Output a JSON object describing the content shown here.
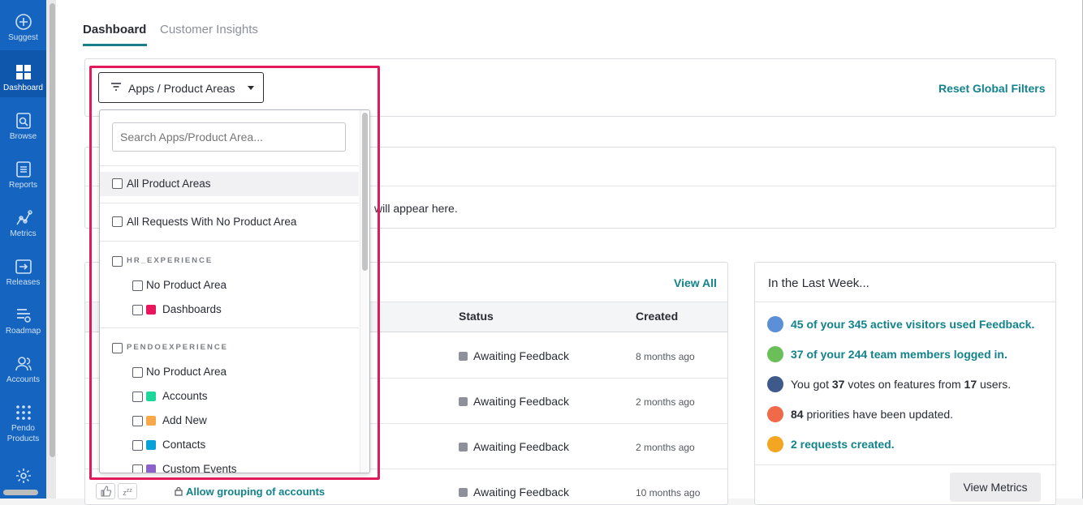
{
  "nav": {
    "suggest": "Suggest",
    "dashboard": "Dashboard",
    "browse": "Browse",
    "reports": "Reports",
    "metrics": "Metrics",
    "releases": "Releases",
    "roadmap": "Roadmap",
    "accounts": "Accounts",
    "pendo": "Pendo",
    "products": "Products"
  },
  "tabs": [
    "Dashboard",
    "Customer Insights"
  ],
  "filters": {
    "button_label": "Apps / Product Areas",
    "reset_label": "Reset Global Filters"
  },
  "empty_text": "will appear here.",
  "requests_panel": {
    "view_all": "View All",
    "col_status": "Status",
    "col_created": "Created",
    "rows": [
      {
        "status": "Awaiting Feedback",
        "created": "8 months ago"
      },
      {
        "status": "Awaiting Feedback",
        "created": "2 months ago"
      },
      {
        "status": "Awaiting Feedback",
        "created": "2 months ago"
      },
      {
        "status": "Awaiting Feedback",
        "created": "10 months ago",
        "title": "Allow grouping of accounts"
      }
    ]
  },
  "last_week": {
    "title": "In the Last Week...",
    "line1": "45 of your 345 active visitors used Feedback.",
    "line2": "37 of your 244 team members logged in.",
    "line3_a": "You got ",
    "line3_b": "37",
    "line3_c": " votes on features from ",
    "line3_d": "17",
    "line3_e": " users.",
    "line4_a": "84",
    "line4_b": " priorities have been updated.",
    "line5": "2 requests created.",
    "view_metrics": "View Metrics",
    "colors": {
      "visitors": "#5b8fd6",
      "team": "#6bbf59",
      "votes": "#3e5a8a",
      "priorities": "#f06a4a",
      "requests": "#f4a623"
    }
  },
  "dropdown": {
    "search_placeholder": "Search Apps/Product Area...",
    "all_areas": "All Product Areas",
    "no_area_requests": "All Requests With No Product Area",
    "groups": [
      {
        "name": "HR_EXPERIENCE",
        "items": [
          {
            "label": "No Product Area",
            "color": ""
          },
          {
            "label": "Dashboards",
            "color": "#e8175d"
          }
        ]
      },
      {
        "name": "PENDOEXPERIENCE",
        "items": [
          {
            "label": "No Product Area",
            "color": ""
          },
          {
            "label": "Accounts",
            "color": "#1fd69a"
          },
          {
            "label": "Add New",
            "color": "#f7a84b"
          },
          {
            "label": "Contacts",
            "color": "#0aa0d8"
          },
          {
            "label": "Custom Events",
            "color": "#8e63c9"
          }
        ]
      }
    ]
  },
  "highlight_color": "#e21a5b"
}
